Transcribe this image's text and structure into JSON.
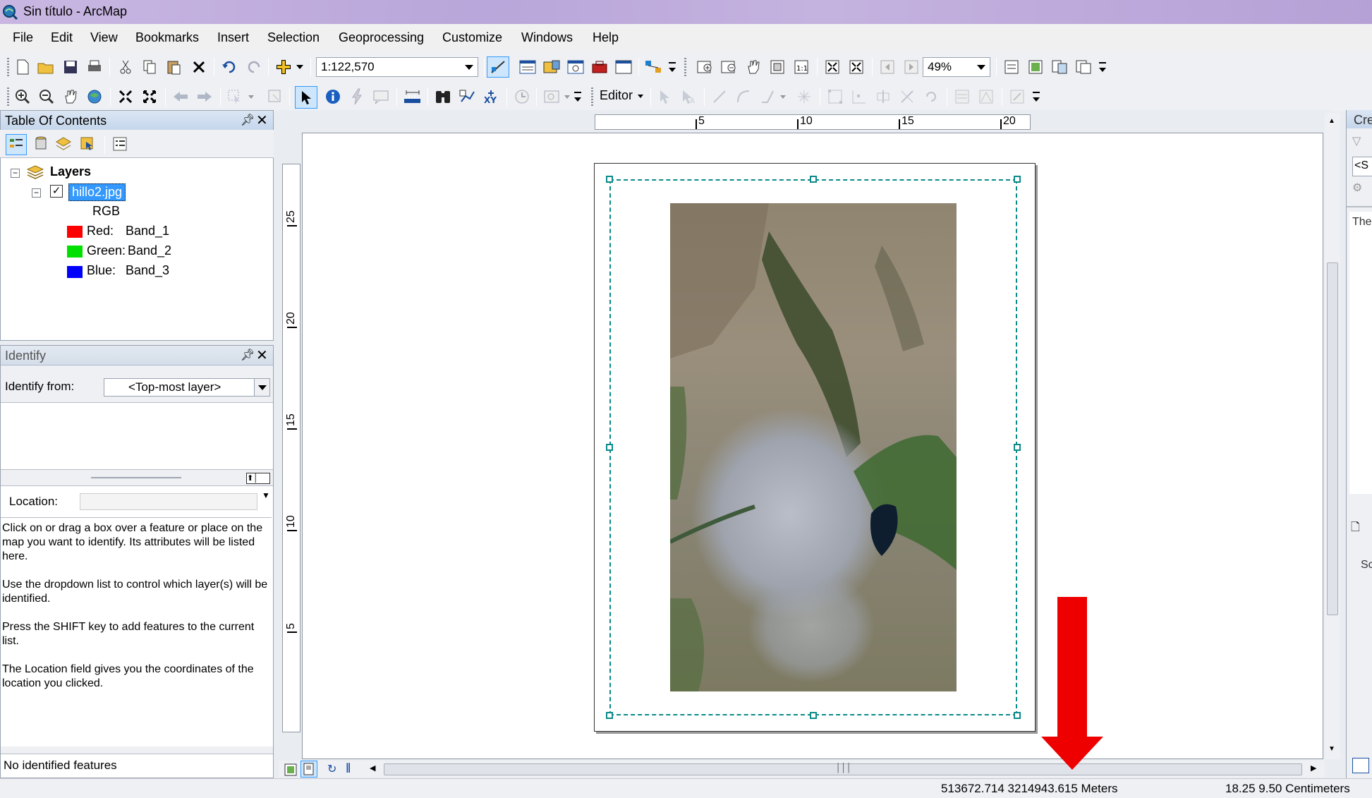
{
  "window": {
    "title": "Sin título - ArcMap"
  },
  "menu": [
    "File",
    "Edit",
    "View",
    "Bookmarks",
    "Insert",
    "Selection",
    "Geoprocessing",
    "Customize",
    "Windows",
    "Help"
  ],
  "toolbar": {
    "scale_value": "1:122,570",
    "layout_zoom": "49%",
    "editor_label": "Editor"
  },
  "toc": {
    "title": "Table Of Contents",
    "root": "Layers",
    "layer": "hillo2.jpg",
    "renderer": "RGB",
    "bands": [
      {
        "channel": "Red:",
        "band": "Band_1",
        "color": "#ff0000"
      },
      {
        "channel": "Green:",
        "band": "Band_2",
        "color": "#00e000"
      },
      {
        "channel": "Blue:",
        "band": "Band_3",
        "color": "#0000ff"
      }
    ]
  },
  "identify": {
    "title": "Identify",
    "from_label": "Identify from:",
    "from_value": "<Top-most layer>",
    "location_label": "Location:",
    "help": [
      "Click on or drag a box over a feature or place on the map you want to identify. Its attributes will be listed here.",
      "Use the dropdown list to control which layer(s) will be identified.",
      "Press the SHIFT key to add features to the current list.",
      "The Location field gives you the coordinates of the location you clicked."
    ],
    "status": "No identified features"
  },
  "rulers": {
    "horizontal": [
      "5",
      "10",
      "15",
      "20"
    ],
    "vertical": [
      "25",
      "20",
      "15",
      "10",
      "5"
    ]
  },
  "right_panel": {
    "title": "Cre",
    "search": "<S",
    "text": "The",
    "bottom": "Sc"
  },
  "statusbar": {
    "map_coords": "513672.714  3214943.615 Meters",
    "page_coords": "18.25  9.50 Centimeters"
  },
  "colors": {
    "accent": "#3399ff",
    "arrow": "#ee0000",
    "selection": "#0b8a8a"
  }
}
